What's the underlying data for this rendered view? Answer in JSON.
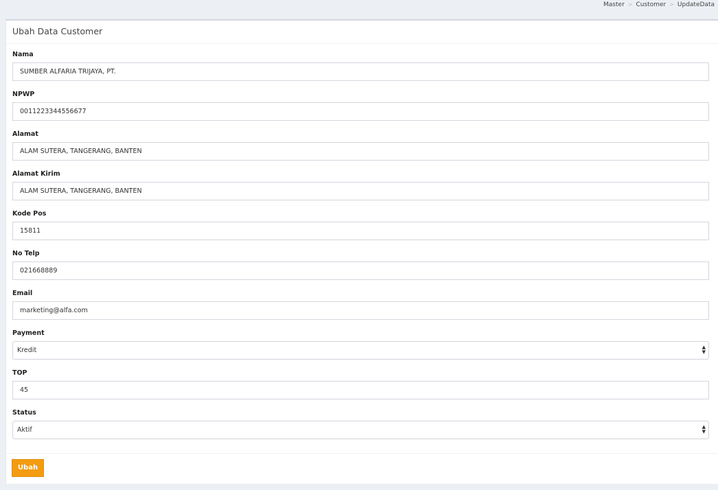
{
  "breadcrumb": [
    "Master",
    "Customer",
    "UpdateData"
  ],
  "card": {
    "title": "Ubah Data Customer"
  },
  "fields": [
    {
      "label": "Nama",
      "value": "SUMBER ALFARIA TRIJAYA, PT."
    },
    {
      "label": "NPWP",
      "value": "0011223344556677"
    },
    {
      "label": "Alamat",
      "value": "ALAM SUTERA, TANGERANG, BANTEN"
    },
    {
      "label": "Alamat Kirim",
      "value": "ALAM SUTERA, TANGERANG, BANTEN"
    },
    {
      "label": "Kode Pos",
      "value": "15811"
    },
    {
      "label": "No Telp",
      "value": "021668889"
    },
    {
      "label": "Email",
      "value": "marketing@alfa.com"
    },
    {
      "label": "Payment",
      "value": "Kredit"
    },
    {
      "label": "TOP",
      "value": "45"
    },
    {
      "label": "Status",
      "value": "Aktif"
    }
  ],
  "submit_label": "Ubah",
  "icons": {
    "breadcrumb_separator": ">",
    "select_arrows": "up-down-arrows-icon"
  },
  "colors": {
    "accent": "#f39c12",
    "background": "#ecf0f5"
  }
}
